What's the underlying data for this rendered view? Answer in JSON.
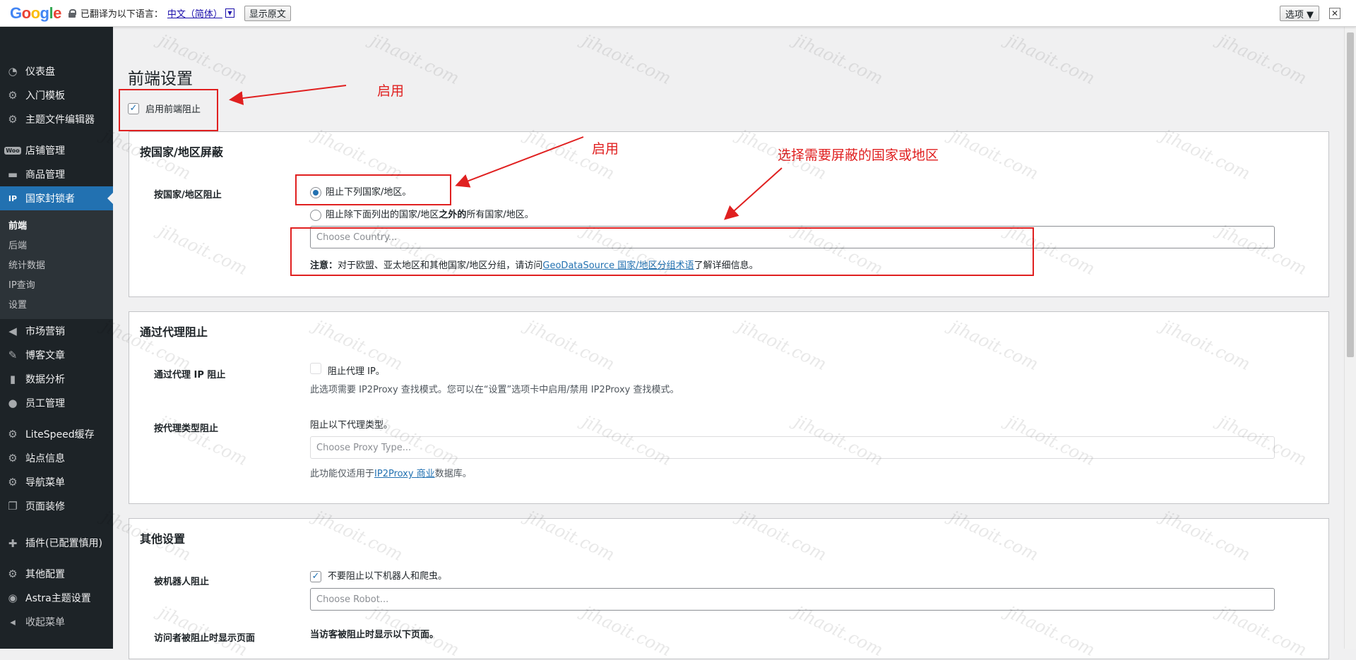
{
  "translate_bar": {
    "logo": "Google",
    "translated_to": "已翻译为以下语言：",
    "language": "中文（简体）",
    "show_original": "显示原文",
    "options": "选项 ▼",
    "close": "✕"
  },
  "sidebar": {
    "items": [
      {
        "label": "仪表盘",
        "icon": "dashboard-icon"
      },
      {
        "label": "入门模板",
        "icon": "gear-icon"
      },
      {
        "label": "主题文件编辑器",
        "icon": "gear-icon"
      },
      {
        "label": "店铺管理",
        "icon": "woo-icon"
      },
      {
        "label": "商品管理",
        "icon": "box-icon"
      },
      {
        "label": "国家封锁者",
        "icon": "ip-icon"
      },
      {
        "label": "市场营销",
        "icon": "megaphone-icon"
      },
      {
        "label": "博客文章",
        "icon": "pin-icon"
      },
      {
        "label": "数据分析",
        "icon": "bar-chart-icon"
      },
      {
        "label": "员工管理",
        "icon": "user-icon"
      },
      {
        "label": "LiteSpeed缓存",
        "icon": "gear-icon"
      },
      {
        "label": "站点信息",
        "icon": "gear-icon"
      },
      {
        "label": "导航菜单",
        "icon": "gear-icon"
      },
      {
        "label": "页面装修",
        "icon": "pages-icon"
      },
      {
        "label": "插件(已配置慎用)",
        "icon": "plugin-icon"
      },
      {
        "label": "其他配置",
        "icon": "gear-icon"
      },
      {
        "label": "Astra主题设置",
        "icon": "astra-icon"
      },
      {
        "label": "收起菜单",
        "icon": "collapse-icon"
      }
    ],
    "submenu": [
      "前端",
      "后端",
      "统计数据",
      "IP查询",
      "设置"
    ]
  },
  "page": {
    "title": "前端设置",
    "enable_label": "启用前端阻止"
  },
  "country_section": {
    "title": "按国家/地区屏蔽",
    "row_label": "按国家/地区阻止",
    "radio1": "阻止下列国家/地区。",
    "radio2_pre": "阻止除下面列出的国家/地区",
    "radio2_bold": "之外的",
    "radio2_post": "所有国家/地区。",
    "country_placeholder": "Choose Country...",
    "note_bold": "注意：",
    "note_text": "对于欧盟、亚太地区和其他国家/地区分组，请访问",
    "note_link": "GeoDataSource 国家/地区分组术语",
    "note_tail": "了解详细信息。"
  },
  "proxy_section": {
    "title": "通过代理阻止",
    "row1_label": "通过代理 IP 阻止",
    "row1_check": "阻止代理 IP。",
    "row1_desc": "此选项需要 IP2Proxy 查找模式。您可以在“设置”选项卡中启用/禁用 IP2Proxy 查找模式。",
    "row2_label": "按代理类型阻止",
    "row2_text": "阻止以下代理类型。",
    "proxy_placeholder": "Choose Proxy Type...",
    "row2_desc_pre": "此功能仅适用于",
    "row2_link": "IP2Proxy 商业",
    "row2_desc_post": "数据库。"
  },
  "other_section": {
    "title": "其他设置",
    "row1_label": "被机器人阻止",
    "row1_check": "不要阻止以下机器人和爬虫。",
    "robot_placeholder": "Choose Robot...",
    "row2_label": "访问者被阻止时显示页面",
    "row2_text": "当访客被阻止时显示以下页面。"
  },
  "annotations": {
    "enable1": "启用",
    "enable2": "启用",
    "select_country": "选择需要屏蔽的国家或地区"
  },
  "watermark": "jihaoit.com",
  "colors": {
    "accent": "#2271b1",
    "sidebar_bg": "#1d2327",
    "annotation": "#e02020"
  }
}
